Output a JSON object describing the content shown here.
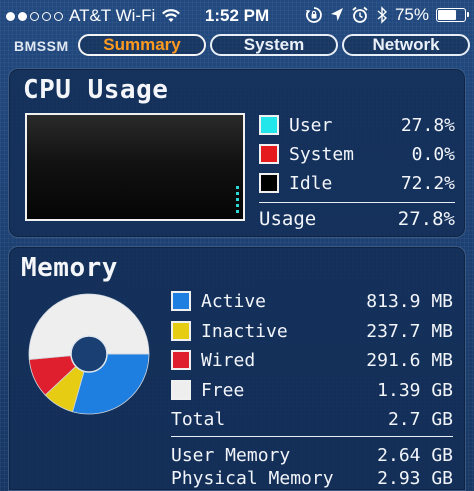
{
  "status_bar": {
    "carrier": "AT&T Wi-Fi",
    "time": "1:52 PM",
    "battery": "75%",
    "battery_level": 0.75,
    "signal_bars_filled": 2,
    "signal_bars_total": 5
  },
  "tabbar": {
    "brand": "BMSSM",
    "tabs": [
      {
        "label": "Summary",
        "active": true
      },
      {
        "label": "System",
        "active": false
      },
      {
        "label": "Network",
        "active": false
      }
    ]
  },
  "cpu": {
    "title": "CPU Usage",
    "rows": [
      {
        "label": "User",
        "value": "27.8%",
        "color": "#22e6ea"
      },
      {
        "label": "System",
        "value": "0.0%",
        "color": "#e41a1c"
      },
      {
        "label": "Idle",
        "value": "72.2%",
        "color": "#000000"
      }
    ],
    "usage_label": "Usage",
    "usage_value": "27.8%",
    "usage_fraction": 0.278
  },
  "memory": {
    "title": "Memory",
    "rows": [
      {
        "label": "Active",
        "value": "813.9 MB",
        "color": "#1e7fe0",
        "mb": 813.9
      },
      {
        "label": "Inactive",
        "value": "237.7 MB",
        "color": "#e6cc12",
        "mb": 237.7
      },
      {
        "label": "Wired",
        "value": "291.6 MB",
        "color": "#df1f2d",
        "mb": 291.6
      },
      {
        "label": "Free",
        "value": "1.39 GB",
        "color": "#eeeeee",
        "mb": 1423.4
      }
    ],
    "total_label": "Total",
    "total_value": "2.7 GB",
    "user_memory_label": "User Memory",
    "user_memory_value": "2.64 GB",
    "physical_memory_label": "Physical Memory",
    "physical_memory_value": "2.93 GB"
  }
}
